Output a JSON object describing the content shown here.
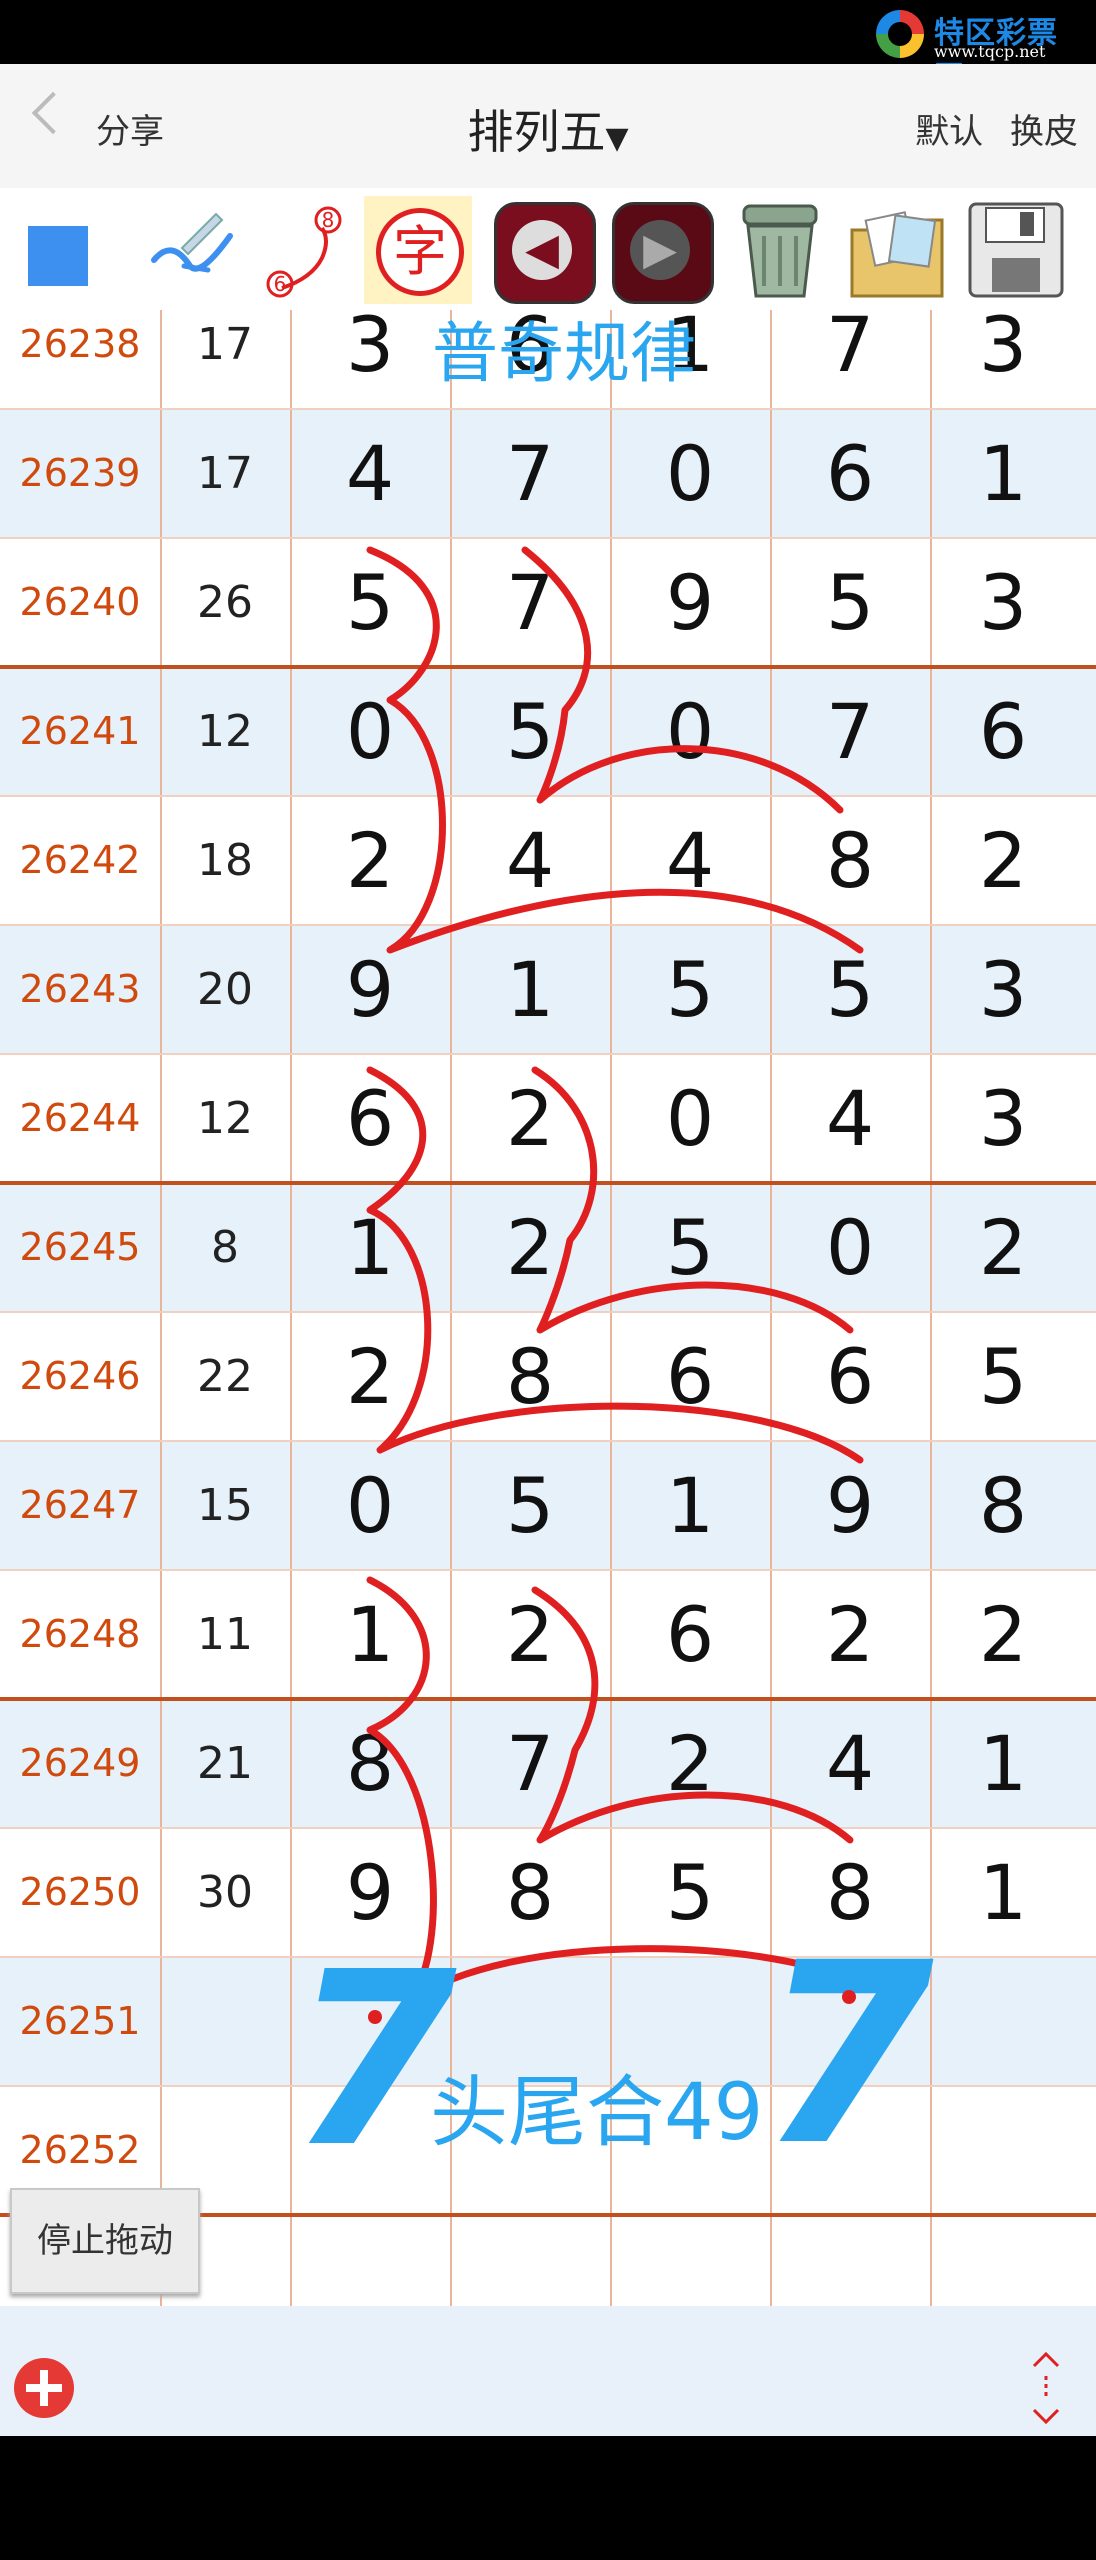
{
  "logo": {
    "name": "特区彩票网",
    "url": "www.tqcp.net"
  },
  "header": {
    "back_label": "分享",
    "title": "排列五",
    "skin_default": "默认",
    "skin_change": "换皮"
  },
  "toolbar": {
    "tools": [
      "color-square-icon",
      "pen-icon",
      "line-tool-icon",
      "text-tool-icon",
      "undo-icon",
      "redo-icon",
      "trash-icon",
      "image-icon",
      "save-icon"
    ],
    "line_tool_badge_top": "8",
    "line_tool_badge_bottom": "6",
    "text_tool_char": "字",
    "accent_color": "#3d8ff0"
  },
  "rows": [
    {
      "id": "26238",
      "sum": "17",
      "digits": [
        "3",
        "6",
        "1",
        "7",
        "3"
      ]
    },
    {
      "id": "26239",
      "sum": "17",
      "digits": [
        "4",
        "7",
        "0",
        "6",
        "1"
      ]
    },
    {
      "id": "26240",
      "sum": "26",
      "digits": [
        "5",
        "7",
        "9",
        "5",
        "3"
      ]
    },
    {
      "id": "26241",
      "sum": "12",
      "digits": [
        "0",
        "5",
        "0",
        "7",
        "6"
      ]
    },
    {
      "id": "26242",
      "sum": "18",
      "digits": [
        "2",
        "4",
        "4",
        "8",
        "2"
      ]
    },
    {
      "id": "26243",
      "sum": "20",
      "digits": [
        "9",
        "1",
        "5",
        "5",
        "3"
      ]
    },
    {
      "id": "26244",
      "sum": "12",
      "digits": [
        "6",
        "2",
        "0",
        "4",
        "3"
      ]
    },
    {
      "id": "26245",
      "sum": "8",
      "digits": [
        "1",
        "2",
        "5",
        "0",
        "2"
      ]
    },
    {
      "id": "26246",
      "sum": "22",
      "digits": [
        "2",
        "8",
        "6",
        "6",
        "5"
      ]
    },
    {
      "id": "26247",
      "sum": "15",
      "digits": [
        "0",
        "5",
        "1",
        "9",
        "8"
      ]
    },
    {
      "id": "26248",
      "sum": "11",
      "digits": [
        "1",
        "2",
        "6",
        "2",
        "2"
      ]
    },
    {
      "id": "26249",
      "sum": "21",
      "digits": [
        "8",
        "7",
        "2",
        "4",
        "1"
      ]
    },
    {
      "id": "26250",
      "sum": "30",
      "digits": [
        "9",
        "8",
        "5",
        "8",
        "1"
      ]
    },
    {
      "id": "26251",
      "sum": "",
      "digits": [
        "",
        "",
        "",
        "",
        ""
      ]
    },
    {
      "id": "26252",
      "sum": "",
      "digits": [
        "",
        "",
        "",
        "",
        ""
      ]
    }
  ],
  "annotations": {
    "top_note": "普奇规律",
    "bottom_note": "头尾合49",
    "left_mark": "7",
    "right_mark": "7"
  },
  "footer": {
    "stop_drag": "停止拖动"
  },
  "colors": {
    "pen_red": "#e02020",
    "annotation_blue": "#2aa6f0",
    "id_orange": "#d04a0e",
    "row_shade": "#e6f1fa"
  }
}
